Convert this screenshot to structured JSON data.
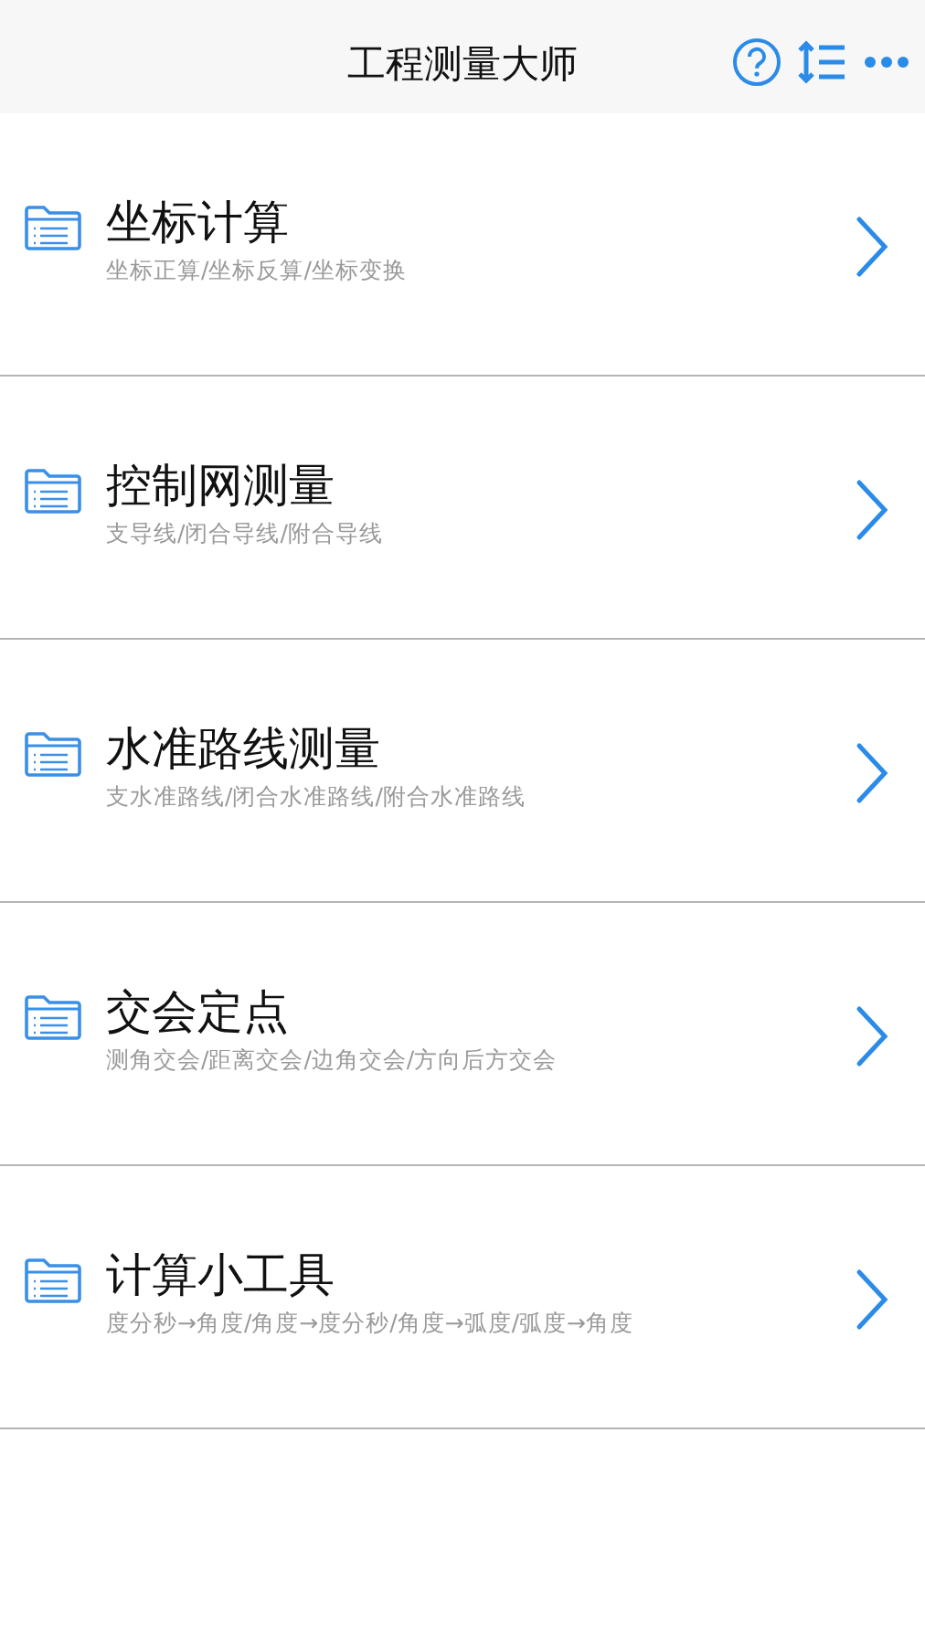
{
  "header": {
    "title": "工程测量大师"
  },
  "menu_items": [
    {
      "title": "坐标计算",
      "subtitle": "坐标正算/坐标反算/坐标变换"
    },
    {
      "title": "控制网测量",
      "subtitle": "支导线/闭合导线/附合导线"
    },
    {
      "title": "水准路线测量",
      "subtitle": "支水准路线/闭合水准路线/附合水准路线"
    },
    {
      "title": "交会定点",
      "subtitle": "测角交会/距离交会/边角交会/方向后方交会"
    },
    {
      "title": "计算小工具",
      "subtitle": "度分秒→角度/角度→度分秒/角度→弧度/弧度→角度"
    }
  ]
}
